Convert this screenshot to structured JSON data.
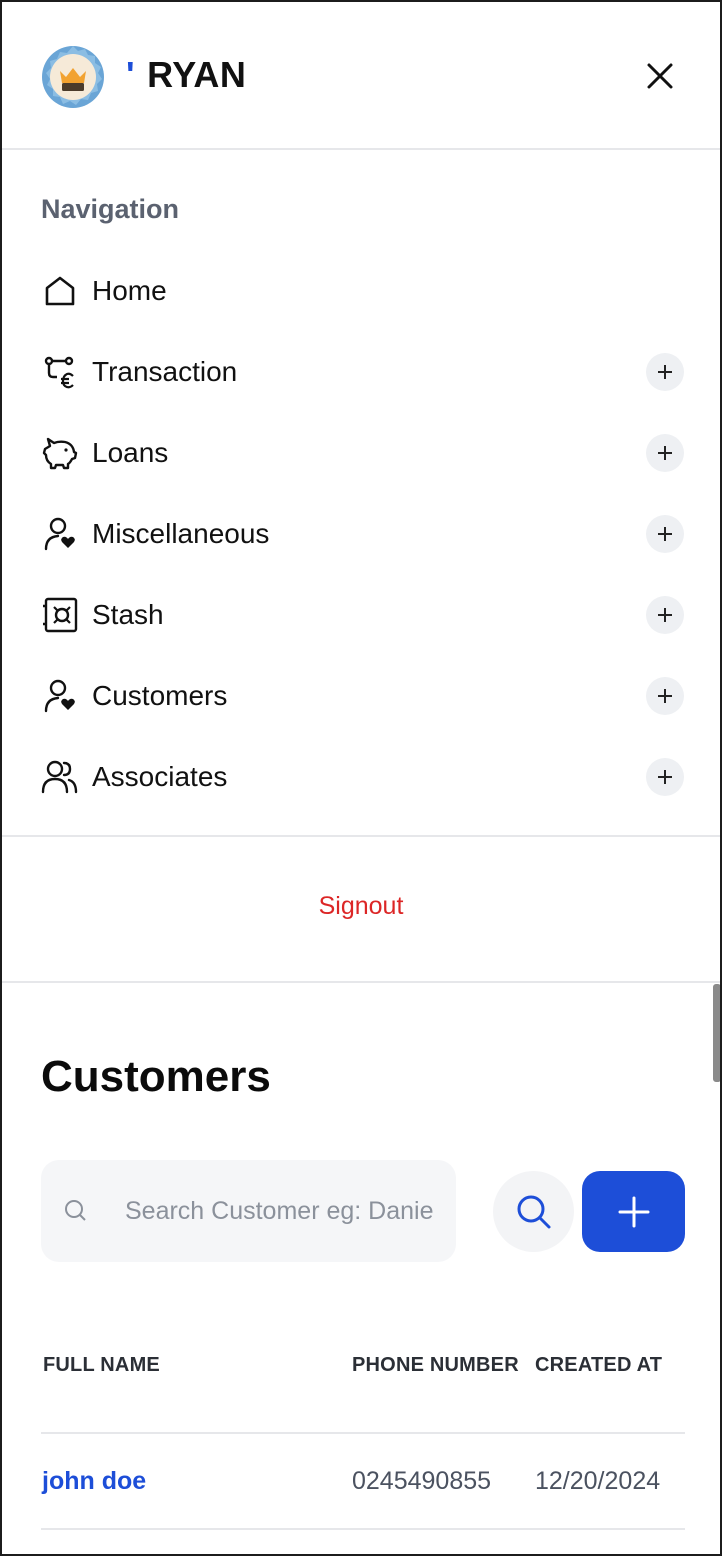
{
  "header": {
    "brand_tick": "'",
    "brand_name": "RYAN",
    "logo_icon": "crown-badge-icon",
    "close_icon": "close-icon"
  },
  "navigation": {
    "heading": "Navigation",
    "items": [
      {
        "label": "Home",
        "icon": "home-icon",
        "expandable": false
      },
      {
        "label": "Transaction",
        "icon": "transaction-icon",
        "expandable": true
      },
      {
        "label": "Loans",
        "icon": "piggy-bank-icon",
        "expandable": true
      },
      {
        "label": "Miscellaneous",
        "icon": "user-heart-icon",
        "expandable": true
      },
      {
        "label": "Stash",
        "icon": "vault-icon",
        "expandable": true
      },
      {
        "label": "Customers",
        "icon": "user-heart-icon",
        "expandable": true
      },
      {
        "label": "Associates",
        "icon": "users-icon",
        "expandable": true
      }
    ]
  },
  "signout_label": "Signout",
  "customers": {
    "title": "Customers",
    "search_placeholder": "Search Customer eg: Daniel",
    "columns": [
      "FULL NAME",
      "PHONE NUMBER",
      "CREATED AT"
    ],
    "rows": [
      {
        "full_name": "john doe",
        "phone": "0245490855",
        "created_at": "12/20/2024"
      }
    ]
  },
  "colors": {
    "accent": "#1d4ed8",
    "signout": "#dc2626",
    "muted_heading": "#5b6270",
    "divider": "#e6e7ea"
  }
}
